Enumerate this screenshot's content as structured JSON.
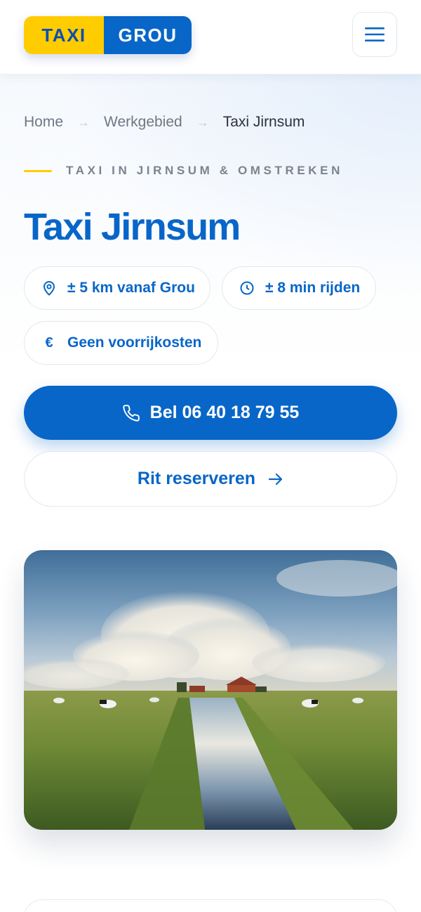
{
  "header": {
    "logo_left": "TAXI",
    "logo_right": "GROU",
    "menu_icon": "hamburger-menu-icon"
  },
  "breadcrumb": {
    "items": [
      "Home",
      "Werkgebied",
      "Taxi Jirnsum"
    ],
    "separator_icon": "arrow-right-icon"
  },
  "hero": {
    "eyebrow": "TAXI IN JIRNSUM & OMSTREKEN",
    "title": "Taxi Jirnsum",
    "chips": [
      {
        "icon": "map-pin-icon",
        "label": "± 5 km vanaf Grou"
      },
      {
        "icon": "clock-icon",
        "label": "± 8 min rijden"
      },
      {
        "icon": "euro-icon",
        "label": "Geen voorrijkosten"
      }
    ],
    "call_button": {
      "icon": "phone-icon",
      "label": "Bel 06 40 18 79 55"
    },
    "reserve_button": {
      "icon": "arrow-right-icon",
      "label": "Rit reserveren"
    }
  },
  "colors": {
    "brand_blue": "#0866c8",
    "brand_yellow": "#ffcc00",
    "muted_text": "#6e7784"
  }
}
